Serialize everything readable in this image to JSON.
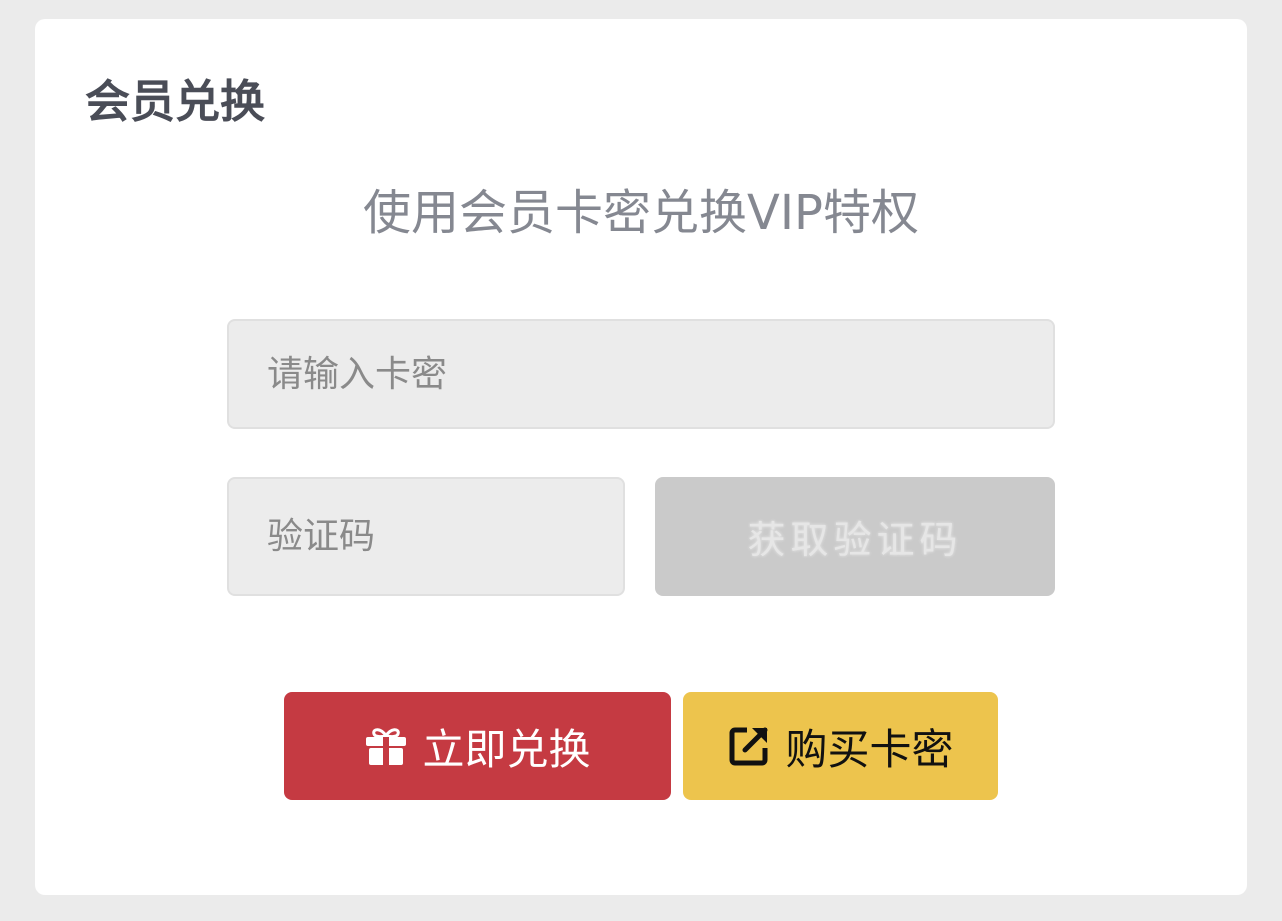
{
  "card": {
    "title": "会员兑换",
    "subtitle": "使用会员卡密兑换VIP特权"
  },
  "form": {
    "card_key_placeholder": "请输入卡密",
    "captcha_placeholder": "验证码",
    "get_code_label": "获取验证码"
  },
  "actions": {
    "redeem_label": "立即兑换",
    "redeem_icon": "gift-icon",
    "redeem_color": "#c53a42",
    "buy_label": "购买卡密",
    "buy_icon": "external-link-icon",
    "buy_color": "#edc44d"
  }
}
